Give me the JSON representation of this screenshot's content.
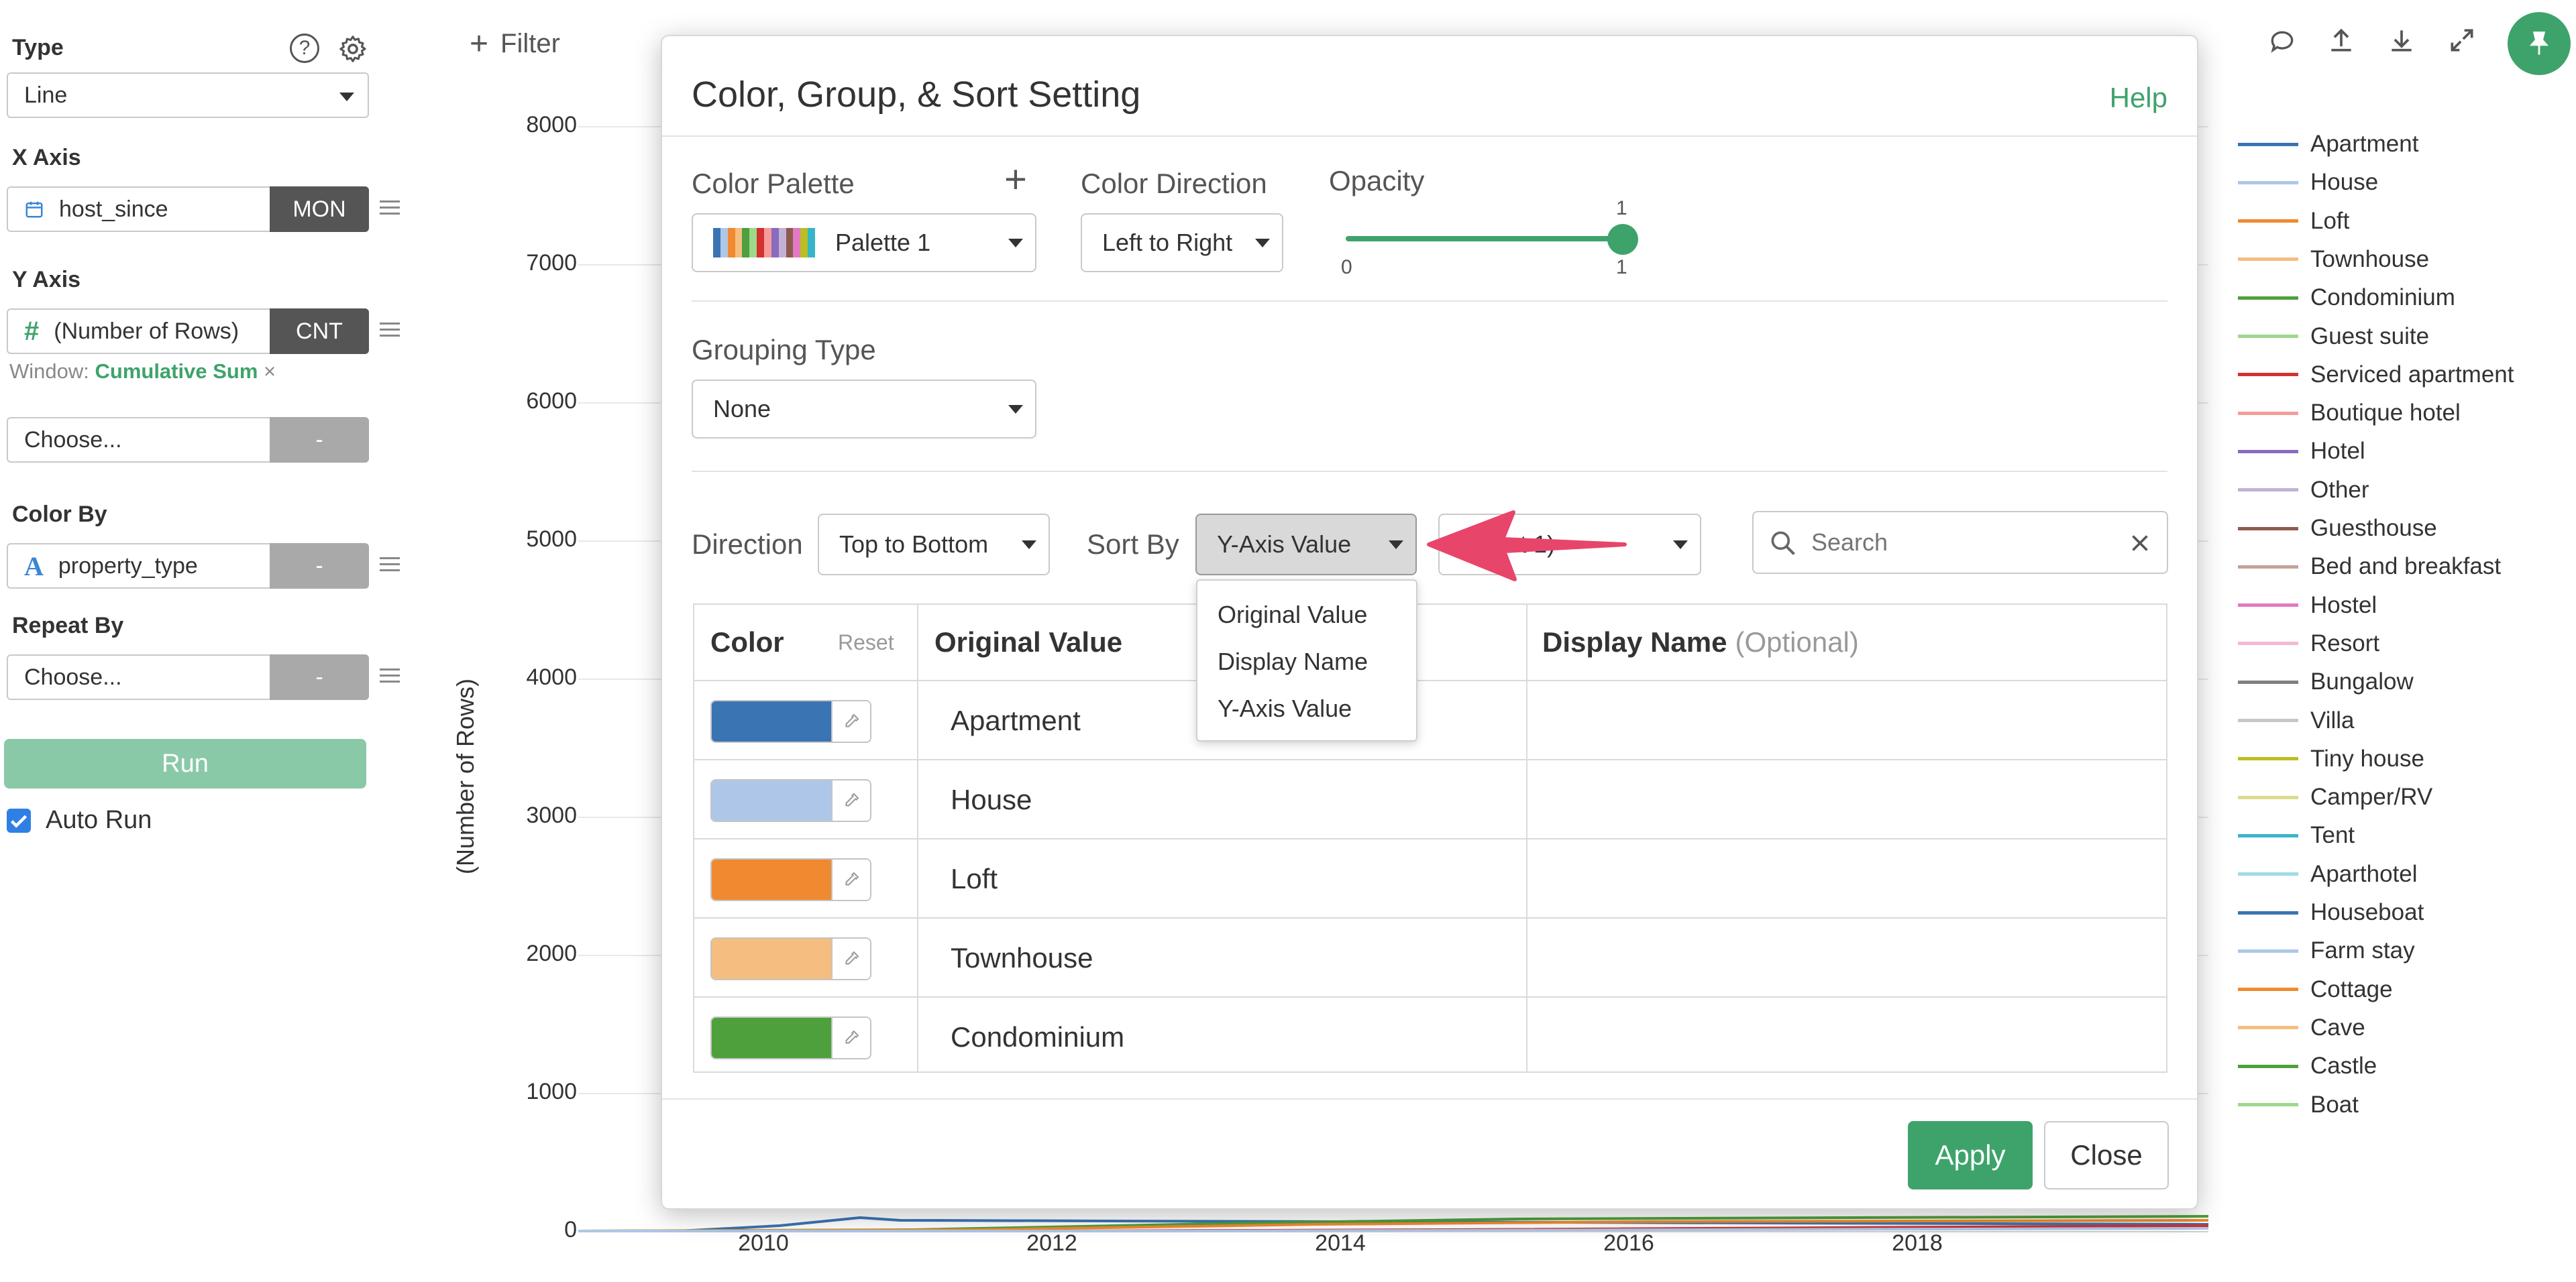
{
  "left_panel": {
    "type": {
      "label": "Type",
      "value": "Line"
    },
    "x_axis": {
      "label": "X Axis",
      "field": "host_since",
      "aggregate": "MON"
    },
    "y_axis": {
      "label": "Y Axis",
      "field": "(Number of Rows)",
      "aggregate": "CNT",
      "window_prefix": "Window:",
      "window_value": "Cumulative Sum",
      "window_clear": "×"
    },
    "extra": {
      "value": "Choose...",
      "aggregate": "-"
    },
    "color_by": {
      "label": "Color By",
      "field": "property_type",
      "aggregate": "-"
    },
    "repeat_by": {
      "label": "Repeat By",
      "value": "Choose...",
      "aggregate": "-"
    },
    "run_label": "Run",
    "auto_run_label": "Auto Run",
    "auto_run_checked": true
  },
  "toolbar": {
    "filter_label": "Filter"
  },
  "chart": {
    "ylabel": "(Number of Rows)",
    "yticks": [
      "8000",
      "7000",
      "6000",
      "5000",
      "4000",
      "3000",
      "2000",
      "1000",
      "0"
    ],
    "xticks": [
      "2010",
      "2012",
      "2014",
      "2016",
      "2018"
    ]
  },
  "legend": [
    {
      "name": "Apartment",
      "color": "#3a74b2"
    },
    {
      "name": "House",
      "color": "#aec7e8"
    },
    {
      "name": "Loft",
      "color": "#f08a30"
    },
    {
      "name": "Townhouse",
      "color": "#f5bd80"
    },
    {
      "name": "Condominium",
      "color": "#4ea03c"
    },
    {
      "name": "Guest suite",
      "color": "#9dd98a"
    },
    {
      "name": "Serviced apartment",
      "color": "#d3302f"
    },
    {
      "name": "Boutique hotel",
      "color": "#f59c9a"
    },
    {
      "name": "Hotel",
      "color": "#8a6bbf"
    },
    {
      "name": "Other",
      "color": "#c2b2d6"
    },
    {
      "name": "Guesthouse",
      "color": "#8f5a4e"
    },
    {
      "name": "Bed and breakfast",
      "color": "#c5a39a"
    },
    {
      "name": "Hostel",
      "color": "#e27ac2"
    },
    {
      "name": "Resort",
      "color": "#f5b8d2"
    },
    {
      "name": "Bungalow",
      "color": "#7f7f7f"
    },
    {
      "name": "Villa",
      "color": "#c7c7c7"
    },
    {
      "name": "Tiny house",
      "color": "#bcbd22"
    },
    {
      "name": "Camper/RV",
      "color": "#dbdb8d"
    },
    {
      "name": "Tent",
      "color": "#35b6c8"
    },
    {
      "name": "Aparthotel",
      "color": "#9edae5"
    },
    {
      "name": "Houseboat",
      "color": "#3a74b2"
    },
    {
      "name": "Farm stay",
      "color": "#aec7e8"
    },
    {
      "name": "Cottage",
      "color": "#f08a30"
    },
    {
      "name": "Cave",
      "color": "#f5bd80"
    },
    {
      "name": "Castle",
      "color": "#4ea03c"
    },
    {
      "name": "Boat",
      "color": "#9dd98a"
    }
  ],
  "dialog": {
    "title": "Color, Group, & Sort Setting",
    "help_label": "Help",
    "color_palette": {
      "label": "Color Palette",
      "add": "+",
      "value": "Palette 1",
      "stripe_colors": [
        "#3a74b2",
        "#aec7e8",
        "#f08a30",
        "#f5bd80",
        "#4ea03c",
        "#9dd98a",
        "#d3302f",
        "#f59c9a",
        "#8a6bbf",
        "#c2b2d6",
        "#8f5a4e",
        "#e27ac2",
        "#bcbd22",
        "#35b6c8"
      ]
    },
    "color_direction": {
      "label": "Color Direction",
      "value": "Left to Right"
    },
    "opacity": {
      "label": "Opacity",
      "value": 1,
      "current_label": "1",
      "min_label": "0",
      "max_label": "1"
    },
    "grouping_type": {
      "label": "Grouping Type",
      "value": "None"
    },
    "direction": {
      "label": "Direction",
      "value": "Top to Bottom"
    },
    "sort_by": {
      "label": "Sort By",
      "value": "Y-Axis Value",
      "options": [
        "Original Value",
        "Display Name",
        "Y-Axis Value"
      ]
    },
    "aggregate_select": {
      "value_partial": "t 1)"
    },
    "search": {
      "placeholder": "Search"
    },
    "table": {
      "col_color": "Color",
      "reset_label": "Reset",
      "col_original": "Original Value",
      "col_display": "Display Name",
      "col_display_optional": "(Optional)",
      "rows": [
        {
          "value": "Apartment",
          "color": "#3a74b2"
        },
        {
          "value": "House",
          "color": "#aec7e8"
        },
        {
          "value": "Loft",
          "color": "#f08a30"
        },
        {
          "value": "Townhouse",
          "color": "#f5bd80"
        },
        {
          "value": "Condominium",
          "color": "#4ea03c"
        }
      ]
    },
    "apply_label": "Apply",
    "close_label": "Close"
  },
  "colors": {
    "accent_green": "#3ea36b",
    "arrow_pink": "#e8456a"
  }
}
